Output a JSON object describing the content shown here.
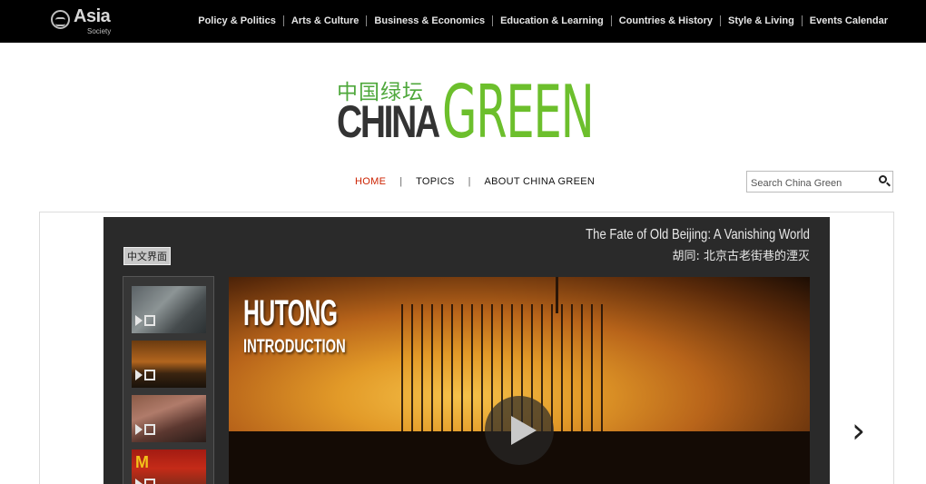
{
  "header": {
    "logo_word": "Asia",
    "logo_sub": "Society",
    "nav": [
      "Policy & Politics",
      "Arts & Culture",
      "Business & Economics",
      "Education & Learning",
      "Countries & History",
      "Style & Living",
      "Events Calendar"
    ]
  },
  "brand": {
    "chinese": "中国绿坛",
    "china": "CHINA",
    "green": "GREEN",
    "accent_color": "#6cbf2c"
  },
  "subnav": {
    "home": "HOME",
    "topics": "TOPICS",
    "about": "ABOUT CHINA GREEN",
    "separator": "|"
  },
  "search": {
    "placeholder": "Search China Green",
    "icon": "search-icon"
  },
  "player": {
    "chinese_button": "中文界面",
    "title_en": "The Fate of Old Beijing: A Vanishing World",
    "title_cn": "胡同:  北京古老街巷的湮灭",
    "video_title": "HUTONG",
    "video_subtitle": "INTRODUCTION",
    "next": "›"
  }
}
